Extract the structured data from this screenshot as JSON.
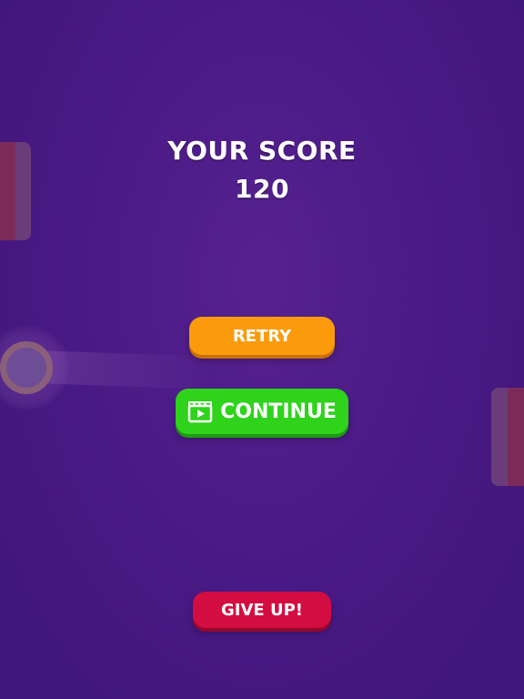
{
  "score": {
    "title": "YOUR SCORE",
    "value": "120"
  },
  "buttons": {
    "retry_label": "RETRY",
    "continue_label": "CONTINUE",
    "continue_icon": "video-clapper-icon",
    "giveup_label": "GIVE UP!"
  },
  "colors": {
    "background": "#4a1a85",
    "retry": "#fb9b0c",
    "continue": "#2fd31c",
    "giveup": "#d30d42"
  }
}
